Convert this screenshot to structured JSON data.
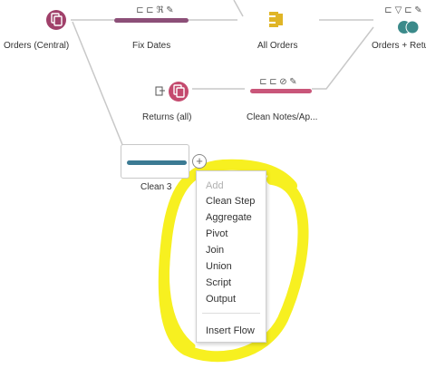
{
  "nodes": {
    "orders_central": {
      "label": "Orders (Central)"
    },
    "fix_dates": {
      "label": "Fix Dates"
    },
    "all_orders": {
      "label": "All Orders"
    },
    "orders_returns": {
      "label": "Orders + Retur"
    },
    "returns_all": {
      "label": "Returns (all)"
    },
    "clean_notes": {
      "label": "Clean Notes/Ap..."
    },
    "clean3": {
      "label": "Clean 3"
    }
  },
  "add_button": {
    "symbol": "+"
  },
  "context_menu": {
    "header": "Add",
    "items": [
      "Clean Step",
      "Aggregate",
      "Pivot",
      "Join",
      "Union",
      "Script",
      "Output"
    ],
    "footer_item": "Insert Flow"
  },
  "colors": {
    "input_node": "#a0406a",
    "clean_bar_purple": "#8c4f78",
    "clean_bar_rose": "#c9567a",
    "clean_bar_teal": "#3b7a93",
    "union_yellow": "#e0b526",
    "join_teal": "#3b8a8a",
    "highlight": "#f7f020",
    "connector": "#c8c8c8"
  },
  "icons": {
    "input": "database-file-icon",
    "union": "union-icon",
    "join": "join-icon",
    "step_tools": [
      "filter-icon",
      "rename-icon",
      "calc-icon",
      "edit-icon"
    ]
  }
}
